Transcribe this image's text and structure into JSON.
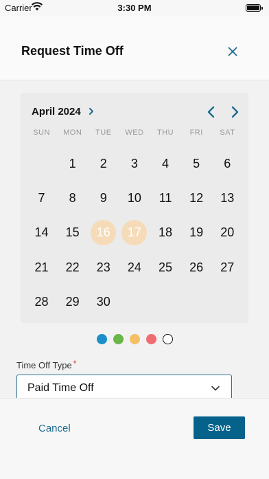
{
  "status_bar": {
    "carrier": "Carrier",
    "time": "3:30 PM"
  },
  "header": {
    "title": "Request Time Off",
    "close_icon": "close-icon"
  },
  "calendar": {
    "month": "April 2024",
    "weekdays": [
      "SUN",
      "MON",
      "TUE",
      "WED",
      "THU",
      "FRI",
      "SAT"
    ],
    "first_day_offset": 1,
    "days": [
      "1",
      "2",
      "3",
      "4",
      "5",
      "6",
      "7",
      "8",
      "9",
      "10",
      "11",
      "12",
      "13",
      "14",
      "15",
      "16",
      "17",
      "18",
      "19",
      "20",
      "21",
      "22",
      "23",
      "24",
      "25",
      "26",
      "27",
      "28",
      "29",
      "30"
    ],
    "selected_days": [
      "16",
      "17"
    ],
    "accent_color": "#1e6b90",
    "selected_color": "#f5dbb8"
  },
  "legend": {
    "colors": [
      "#1a8fc9",
      "#6ab648",
      "#f4c063",
      "#ef6d72",
      "#ffffff"
    ]
  },
  "form": {
    "time_off_type_label": "Time Off Type",
    "required_mark": "*",
    "time_off_type_value": "Paid Time Off"
  },
  "footer": {
    "cancel_label": "Cancel",
    "save_label": "Save"
  }
}
